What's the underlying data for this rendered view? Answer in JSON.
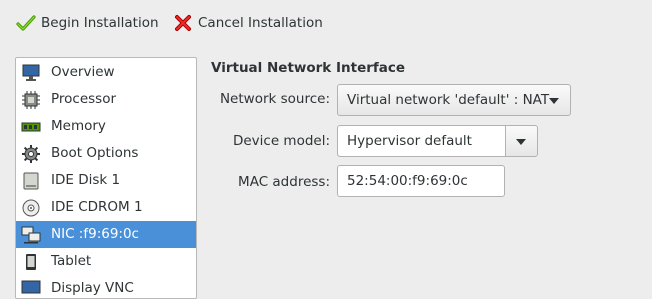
{
  "toolbar": {
    "begin_label": "Begin Installation",
    "cancel_label": "Cancel Installation"
  },
  "sidebar": {
    "items": [
      {
        "label": "Overview",
        "icon": "monitor-icon"
      },
      {
        "label": "Processor",
        "icon": "cpu-chip-icon"
      },
      {
        "label": "Memory",
        "icon": "memory-stick-icon"
      },
      {
        "label": "Boot Options",
        "icon": "gear-icon"
      },
      {
        "label": "IDE Disk 1",
        "icon": "hard-disk-icon"
      },
      {
        "label": "IDE CDROM 1",
        "icon": "cdrom-icon"
      },
      {
        "label": "NIC :f9:69:0c",
        "icon": "network-icon",
        "selected": true
      },
      {
        "label": "Tablet",
        "icon": "tablet-icon"
      },
      {
        "label": "Display VNC",
        "icon": "display-icon"
      }
    ]
  },
  "details": {
    "title": "Virtual Network Interface",
    "network_source_label": "Network source:",
    "network_source_value": "Virtual network 'default' : NAT",
    "device_model_label": "Device model:",
    "device_model_value": "Hypervisor default",
    "mac_label": "MAC address:",
    "mac_value": "52:54:00:f9:69:0c"
  },
  "colors": {
    "selection": "#4a90d9",
    "check_green": "#4e9a06",
    "cancel_red": "#cc0000"
  }
}
